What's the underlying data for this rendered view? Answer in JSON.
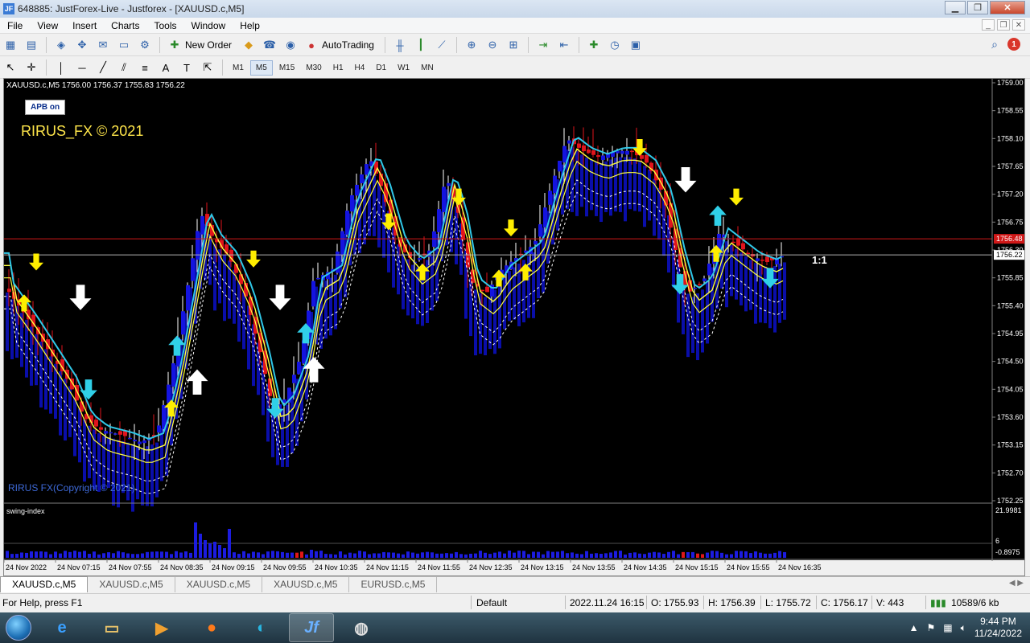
{
  "window": {
    "title": "648885: JustForex-Live - Justforex - [XAUUSD.c,M5]",
    "app_icon": "JF"
  },
  "menu": [
    "File",
    "View",
    "Insert",
    "Charts",
    "Tools",
    "Window",
    "Help"
  ],
  "toolbar": {
    "new_order": "New Order",
    "auto_trading": "AutoTrading",
    "timeframes": [
      "M1",
      "M5",
      "M15",
      "M30",
      "H1",
      "H4",
      "D1",
      "W1",
      "MN"
    ],
    "active_timeframe": "M5"
  },
  "chart": {
    "header": "XAUUSD.c,M5  1756.00 1756.37 1755.83 1756.22",
    "apb_badge": "APB on",
    "brand": "RIRUS_FX © 2021",
    "copyright": "RIRUS FX(Copyright © 2021)",
    "ratio_label": "1:1",
    "price_marker_red": "1756.48",
    "price_marker_white": "1756.22",
    "indicator_name": "swing-index",
    "indicator_labels": [
      "21.9981",
      "6",
      "-0.8975"
    ],
    "price_ticks": [
      "1759.00",
      "1758.55",
      "1758.10",
      "1757.65",
      "1757.20",
      "1756.75",
      "1756.30",
      "1755.85",
      "1755.40",
      "1754.95",
      "1754.50",
      "1754.05",
      "1753.60",
      "1753.15",
      "1752.70",
      "1752.25"
    ],
    "time_ticks": [
      "24 Nov 2022",
      "24 Nov 07:15",
      "24 Nov 07:55",
      "24 Nov 08:35",
      "24 Nov 09:15",
      "24 Nov 09:55",
      "24 Nov 10:35",
      "24 Nov 11:15",
      "24 Nov 11:55",
      "24 Nov 12:35",
      "24 Nov 13:15",
      "24 Nov 13:55",
      "24 Nov 14:35",
      "24 Nov 15:15",
      "24 Nov 15:55",
      "24 Nov 16:35"
    ],
    "colors": {
      "bull": "#1414e0",
      "bear": "#e0141c",
      "ma": "#ffff40",
      "signal_cyan": "#30c8e8",
      "background": "#000000"
    }
  },
  "tabs": [
    "XAUUSD.c,M5",
    "XAUUSD.c,M5",
    "XAUUSD.c,M5",
    "XAUUSD.c,M5",
    "EURUSD.c,M5"
  ],
  "status": {
    "help": "For Help, press F1",
    "profile": "Default",
    "datetime": "2022.11.24 16:15",
    "open": "O: 1755.93",
    "high": "H: 1756.39",
    "low": "L: 1755.72",
    "close": "C: 1756.17",
    "volume": "V: 443",
    "traffic": "10589/6 kb"
  },
  "taskbar": {
    "time": "9:44 PM",
    "date": "11/24/2022"
  }
}
